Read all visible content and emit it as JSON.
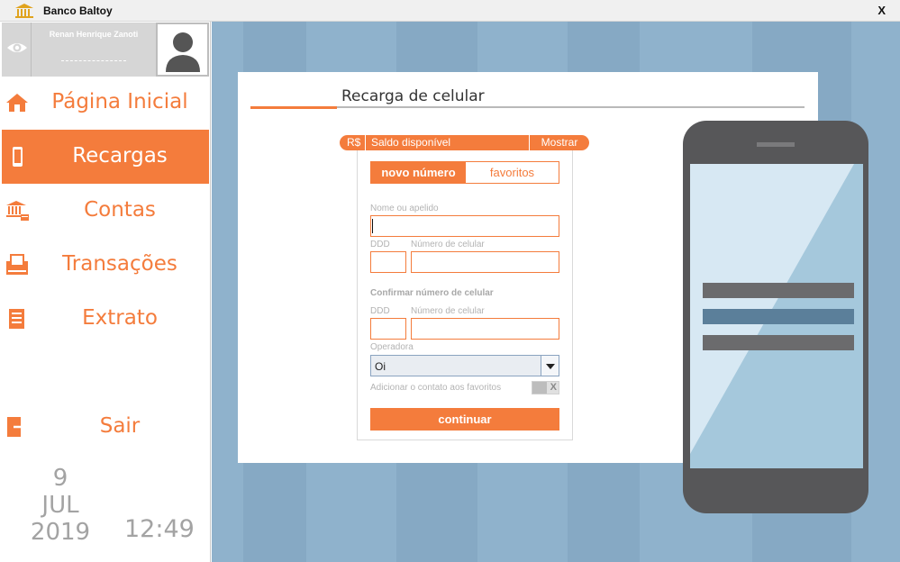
{
  "window": {
    "title": "Banco Baltoy",
    "close_label": "X"
  },
  "user": {
    "name": "Renan Henrique Zanoti"
  },
  "nav": [
    {
      "label": "Página Inicial",
      "icon": "home-icon",
      "active": false
    },
    {
      "label": "Recargas",
      "icon": "phone-icon",
      "active": true
    },
    {
      "label": "Contas",
      "icon": "bank-icon",
      "active": false
    },
    {
      "label": "Transações",
      "icon": "atm-icon",
      "active": false
    },
    {
      "label": "Extrato",
      "icon": "statement-icon",
      "active": false
    }
  ],
  "logout": {
    "label": "Sair",
    "icon": "logout-icon"
  },
  "datetime": {
    "day": "9",
    "month": "JUL",
    "year": "2019",
    "time": "12:49"
  },
  "page": {
    "title": "Recarga de celular"
  },
  "balance": {
    "currency": "R$",
    "label": "Saldo disponível",
    "show_label": "Mostrar"
  },
  "tabs": {
    "new_label": "novo número",
    "favorites_label": "favoritos"
  },
  "form": {
    "nickname_label": "Nome ou apelido",
    "nickname_value": "",
    "ddd_label": "DDD",
    "number_label": "Número de celular",
    "confirm_section": "Confirmar número de celular",
    "confirm_ddd_label": "DDD",
    "confirm_number_label": "Número de celular",
    "operator_label": "Operadora",
    "operator_value": "Oi",
    "add_favorite_label": "Adicionar o contato aos favoritos",
    "toggle_off_label": "X",
    "continue_label": "continuar"
  },
  "colors": {
    "accent": "#f47c3c",
    "background": "#8fb2cc",
    "muted": "#a3a3a3"
  }
}
